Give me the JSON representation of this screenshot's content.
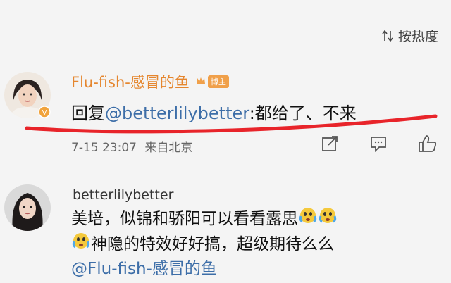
{
  "sort": {
    "label": "按热度",
    "icon": "sort-icon"
  },
  "comment1": {
    "avatar": "avatar-woman-short-hair",
    "username": "Flu-fish-感冒的鱼",
    "badge_label": "博主",
    "reply_prefix": "回复",
    "mention": "@betterlilybetter",
    "reply_text": ":都给了、不来",
    "time": "7-15 23:07",
    "location": "来自北京",
    "actions": [
      "share-icon",
      "comment-icon",
      "like-icon"
    ],
    "highlight_color": "#e8242a"
  },
  "comment2": {
    "avatar": "avatar-woman-long-hair",
    "username": "betterlilybetter",
    "line1_text": "美培，似锦和骄阳可以看看露思",
    "line2_text": "神隐的特效好好搞，超级期待么么",
    "line3_mention": "@Flu-fish-感冒的鱼",
    "emoji": "crying-face-emoji"
  },
  "colors": {
    "mention": "#3d6ea8",
    "vip_name": "#e5862e",
    "background": "#f4f4f4"
  }
}
